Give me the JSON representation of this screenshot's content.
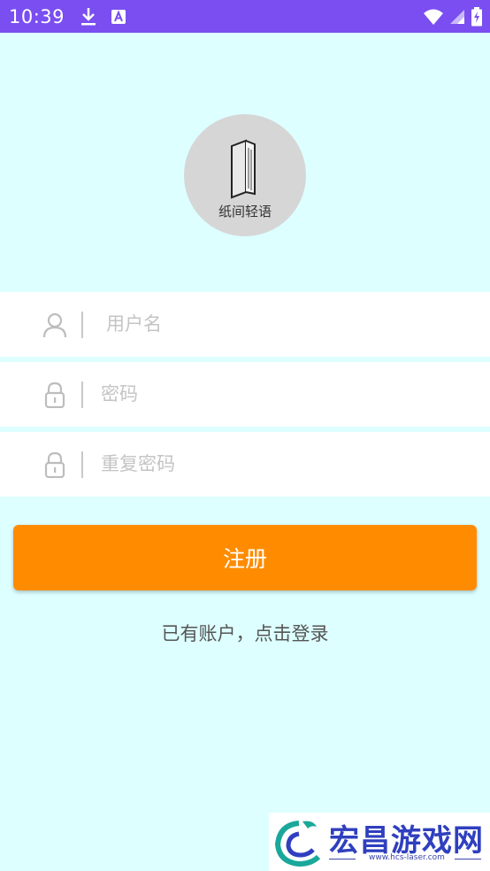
{
  "status_bar": {
    "time": "10:39",
    "icons": [
      "download-icon",
      "a-icon",
      "wifi-icon",
      "signal-icon",
      "battery-charging-icon"
    ]
  },
  "app": {
    "name": "纸间轻语",
    "logo_icon": "book-icon"
  },
  "form": {
    "username": {
      "placeholder": "用户名",
      "value": "",
      "icon": "user-icon"
    },
    "password": {
      "placeholder": "密码",
      "value": "",
      "icon": "lock-icon"
    },
    "confirm_password": {
      "placeholder": "重复密码",
      "value": "",
      "icon": "lock-icon"
    }
  },
  "actions": {
    "register_label": "注册",
    "login_link": "已有账户，点击登录"
  },
  "colors": {
    "status_bar": "#7a4ef0",
    "background": "#ddffff",
    "button": "#ff8c00"
  },
  "watermark": {
    "title": "宏昌游戏网",
    "url": "www.hcs-laser.com"
  }
}
